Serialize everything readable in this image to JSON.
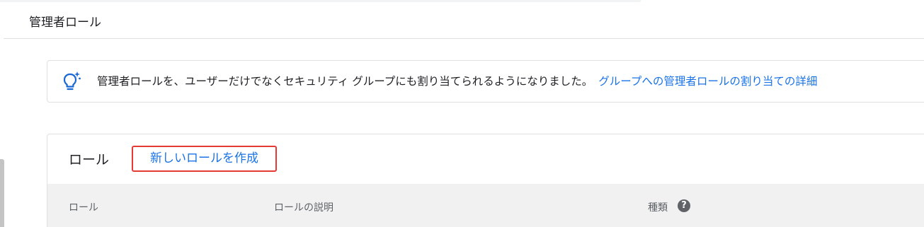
{
  "header": {
    "title": "管理者ロール"
  },
  "notice": {
    "icon": "lightbulb-sparkle-icon",
    "text": "管理者ロールを、ユーザーだけでなくセキュリティ グループにも割り当てられるようになりました。",
    "link_label": "グループへの管理者ロールの割り当ての詳細"
  },
  "roles_card": {
    "title": "ロール",
    "create_button_label": "新しいロールを作成",
    "columns": [
      {
        "label": "ロール"
      },
      {
        "label": "ロールの説明"
      },
      {
        "label": "種類"
      }
    ],
    "help_icon": "help-icon",
    "help_glyph": "?"
  },
  "colors": {
    "link": "#1a73e8",
    "highlight_border": "#e53935",
    "table_header_bg": "#f1f1f1",
    "icon_blue": "#1967d2"
  }
}
